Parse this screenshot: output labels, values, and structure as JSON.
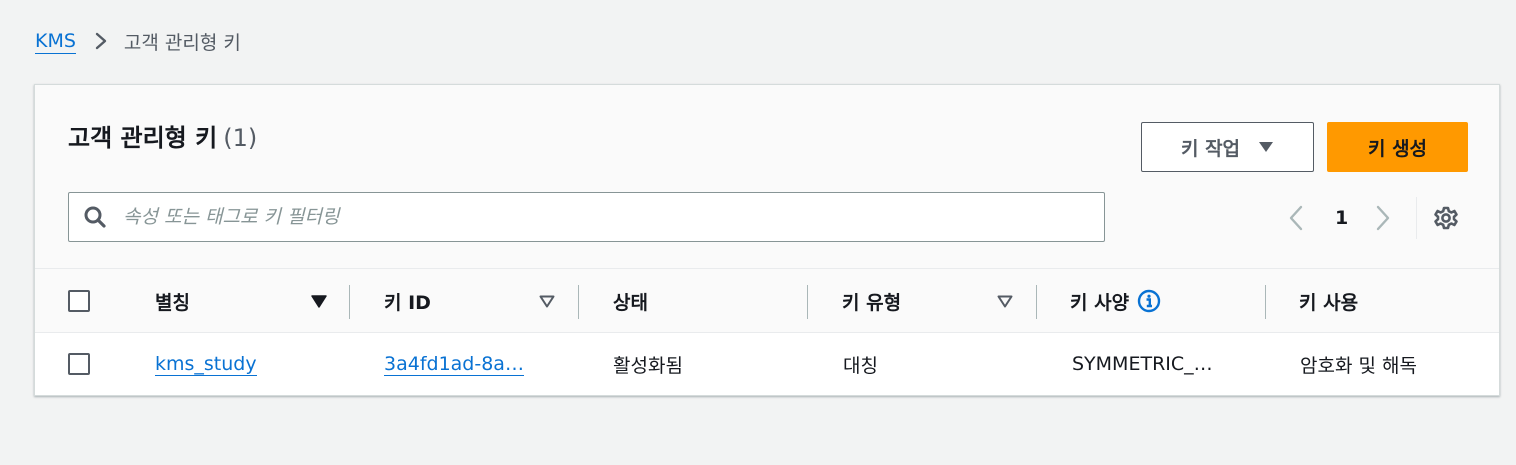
{
  "breadcrumb": {
    "root": "KMS",
    "separator_icon": "chevron-right-icon",
    "current": "고객 관리형 키"
  },
  "panel": {
    "title": "고객 관리형 키",
    "count": "(1)",
    "actions_button": "키 작업",
    "create_button": "키 생성"
  },
  "search": {
    "placeholder": "속성 또는 태그로 키 필터링",
    "value": ""
  },
  "pagination": {
    "current_page": "1"
  },
  "table": {
    "columns": [
      "별칭",
      "키 ID",
      "상태",
      "키 유형",
      "키 사양",
      "키 사용"
    ],
    "rows": [
      {
        "alias": "kms_study",
        "key_id": "3a4fd1ad-8a…",
        "status": "활성화됨",
        "key_type": "대칭",
        "key_spec": "SYMMETRIC_…",
        "key_usage": "암호화 및 해독"
      }
    ]
  },
  "colors": {
    "link": "#0972d3",
    "primary_button": "#ff9900",
    "background": "#f2f3f3",
    "text": "#16191f",
    "muted": "#545b64"
  }
}
